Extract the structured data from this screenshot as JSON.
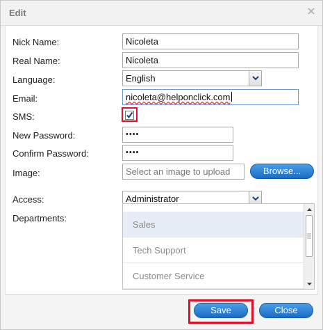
{
  "dialog": {
    "title": "Edit",
    "close_icon": "close-icon"
  },
  "form": {
    "nick_name": {
      "label": "Nick Name:",
      "value": "Nicoleta"
    },
    "real_name": {
      "label": "Real Name:",
      "value": "Nicoleta"
    },
    "language": {
      "label": "Language:",
      "value": "English"
    },
    "email": {
      "label": "Email:",
      "value": "nicoleta@helponclick.com"
    },
    "sms": {
      "label": "SMS:",
      "checked": true
    },
    "new_password": {
      "label": "New Password:",
      "value": "••••"
    },
    "confirm_password": {
      "label": "Confirm Password:",
      "value": "••••"
    },
    "image": {
      "label": "Image:",
      "placeholder": "Select an image to upload",
      "browse_label": "Browse..."
    },
    "access": {
      "label": "Access:",
      "value": "Administrator"
    },
    "departments": {
      "label": "Departments:",
      "items": [
        "Sales",
        "Tech Support",
        "Customer Service"
      ],
      "selected": "Sales"
    }
  },
  "footer": {
    "save_label": "Save",
    "close_label": "Close"
  },
  "colors": {
    "accent": "#1a6cc4",
    "highlight": "#e0102a"
  }
}
